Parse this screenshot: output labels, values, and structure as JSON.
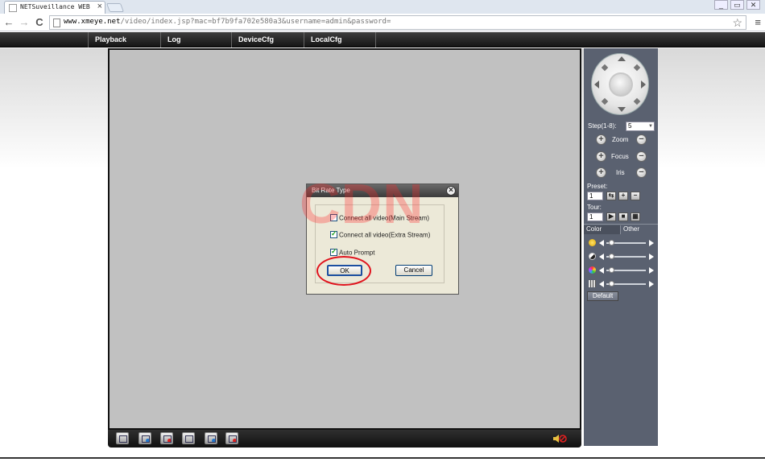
{
  "browser": {
    "tab_title": "NETSuveillance WEB",
    "tab_close": "×",
    "window_controls": [
      "_",
      "▭",
      "✕"
    ],
    "url_domain": "www.xmeye.net",
    "url_path": "/video/index.jsp?mac=bf7b9fa702e580a3&username=admin&password=",
    "back": "←",
    "forward": "→",
    "reload": "C",
    "star": "☆",
    "menu": "≡"
  },
  "nav": {
    "items": [
      "Playback",
      "Log",
      "DeviceCfg",
      "LocalCfg"
    ]
  },
  "dialog": {
    "title": "Bit Rate Type",
    "close": "×",
    "options": [
      {
        "label": "Connect all video(Main Stream)",
        "checked": false
      },
      {
        "label": "Connect all video(Extra Stream)",
        "checked": true
      },
      {
        "label": "Auto Prompt",
        "checked": true
      }
    ],
    "ok_label": "OK",
    "cancel_label": "Cancel"
  },
  "watermark": "CDN",
  "ptz": {
    "step_label": "Step(1-8):",
    "step_value": "5",
    "zoom_label": "Zoom",
    "focus_label": "Focus",
    "iris_label": "Iris",
    "plus": "+",
    "minus": "−",
    "preset_label": "Preset:",
    "preset_value": "1",
    "tour_label": "Tour:",
    "tour_value": "1"
  },
  "color_panel": {
    "tab_color": "Color",
    "tab_other": "Other",
    "sliders": [
      {
        "name": "brightness",
        "value": 0.08
      },
      {
        "name": "contrast",
        "value": 0.08
      },
      {
        "name": "saturation",
        "value": 0.08
      },
      {
        "name": "hue",
        "value": 0.08
      }
    ],
    "default_label": "Default"
  },
  "colors": {
    "panel_bg": "#5a6170",
    "video_bg": "#c1c1c1",
    "dialog_bg": "#ece9d8",
    "highlight": "#e0141e"
  }
}
